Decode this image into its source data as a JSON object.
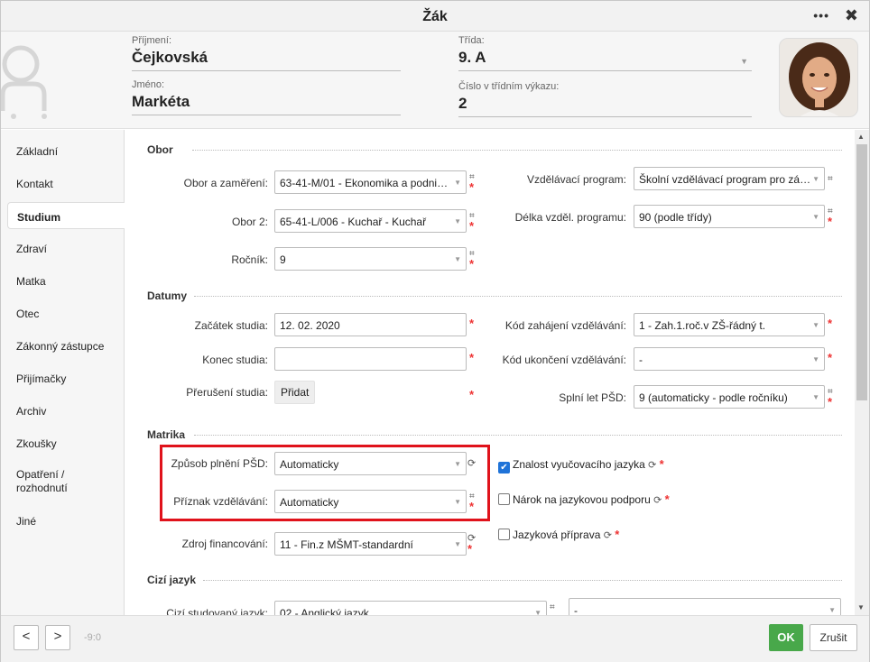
{
  "window": {
    "title": "Žák"
  },
  "header": {
    "surname_label": "Příjmení:",
    "surname": "Čejkovská",
    "firstname_label": "Jméno:",
    "firstname": "Markéta",
    "class_label": "Třída:",
    "class": "9. A",
    "number_label": "Číslo v třídním výkazu:",
    "number": "2"
  },
  "sidebar": {
    "items": [
      {
        "label": "Základní"
      },
      {
        "label": "Kontakt"
      },
      {
        "label": "Studium"
      },
      {
        "label": "Zdraví"
      },
      {
        "label": "Matka"
      },
      {
        "label": "Otec"
      },
      {
        "label": "Zákonný zástupce"
      },
      {
        "label": "Přijímačky"
      },
      {
        "label": "Archiv"
      },
      {
        "label": "Zkoušky"
      },
      {
        "label": "Opatření / rozhodnutí"
      },
      {
        "label": "Jiné"
      }
    ]
  },
  "obor": {
    "title": "Obor",
    "obor_label": "Obor a zaměření:",
    "obor_value": "63-41-M/01 - Ekonomika a podni…",
    "obor2_label": "Obor 2:",
    "obor2_value": "65-41-L/006 - Kuchař - Kuchař",
    "rocnik_label": "Ročník:",
    "rocnik_value": "9",
    "program_label": "Vzdělávací program:",
    "program_value": "Školní vzdělávací program pro zá…",
    "delka_label": "Délka vzděl. programu:",
    "delka_value": "90 (podle třídy)"
  },
  "datumy": {
    "title": "Datumy",
    "zacatek_label": "Začátek studia:",
    "zacatek_value": "12. 02. 2020",
    "konec_label": "Konec studia:",
    "konec_value": "",
    "preruseni_label": "Přerušení studia:",
    "pridat_label": "Přidat",
    "kod_zah_label": "Kód zahájení vzdělávání:",
    "kod_zah_value": "1 - Zah.1.roč.v ZŠ-řádný t.",
    "kod_uk_label": "Kód ukončení vzdělávání:",
    "kod_uk_value": "-",
    "splni_label": "Splní let PŠD:",
    "splni_value": "9 (automaticky - podle ročníku)"
  },
  "matrika": {
    "title": "Matrika",
    "zpusob_label": "Způsob plnění PŠD:",
    "zpusob_value": "Automaticky",
    "priznak_label": "Příznak vzdělávání:",
    "priznak_value": "Automaticky",
    "zdroj_label": "Zdroj financování:",
    "zdroj_value": "11 - Fin.z MŠMT-standardní",
    "znalost_label": "Znalost vyučovacího jazyka",
    "znalost_checked": true,
    "narok_label": "Nárok na jazykovou podporu",
    "narok_checked": false,
    "pripravka_label": "Jazyková příprava",
    "pripravka_checked": false
  },
  "cizi": {
    "title": "Cizí jazyk",
    "jazyk_label": "Cizí studovaný jazyk:",
    "jazyk_value": "02 - Anglický jazyk",
    "second_value": "-"
  },
  "footer": {
    "prev": "<",
    "next": ">",
    "pager": "-9:0",
    "ok": "OK",
    "cancel": "Zrušit"
  },
  "colors": {
    "ok_green": "#48a84a",
    "required_red": "#e33333",
    "highlight_red": "#e0121b",
    "checkbox_blue": "#1f73d8"
  }
}
